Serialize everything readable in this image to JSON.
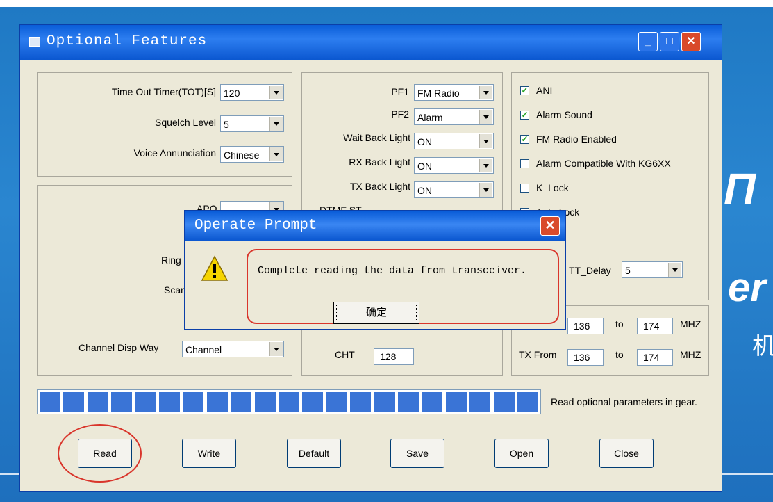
{
  "window": {
    "title": "Optional Features",
    "min": "_",
    "max": "□",
    "close": "✕"
  },
  "timers": {
    "tot_label": "Time Out Timer(TOT)[S]",
    "tot_value": "120",
    "squelch_label": "Squelch Level",
    "squelch_value": "5",
    "voice_label": "Voice Annunciation",
    "voice_value": "Chinese"
  },
  "mid": {
    "pf1_label": "PF1",
    "pf1_value": "FM Radio",
    "pf2_label": "PF2",
    "pf2_value": "Alarm",
    "wait_label": "Wait Back Light",
    "wait_value": "ON",
    "rx_label": "RX Back Light",
    "rx_value": "ON",
    "tx_label": "TX Back Light",
    "tx_value": "ON",
    "dtmf_label": "DTMF ST",
    "cht_label": "CHT",
    "cht_value": "128"
  },
  "left2": {
    "apo_label": "APO",
    "ring_label": "Ring",
    "scan_label": "Scan",
    "disp_label": "Channel Disp Way",
    "disp_value": "Channel"
  },
  "checks": [
    {
      "label": "ANI",
      "checked": true
    },
    {
      "label": "Alarm Sound",
      "checked": true
    },
    {
      "label": "FM Radio Enabled",
      "checked": true
    },
    {
      "label": "Alarm Compatible With KG6XX",
      "checked": false
    },
    {
      "label": "K_Lock",
      "checked": false
    },
    {
      "label": "Auto Lock",
      "checked": false
    }
  ],
  "dtmf_delay": {
    "label": "TT_Delay",
    "value": "5"
  },
  "freq": {
    "rx_to": "to",
    "rx_from_value": "136",
    "rx_to_value": "174",
    "rx_unit": "MHZ",
    "tx_label": "TX From",
    "tx_from_value": "136",
    "tx_to": "to",
    "tx_to_value": "174",
    "tx_unit": "MHZ"
  },
  "progress": {
    "blocks": 21,
    "status": "Read optional parameters in gear."
  },
  "buttons": {
    "read": "Read",
    "write": "Write",
    "default": "Default",
    "save": "Save",
    "open": "Open",
    "close": "Close"
  },
  "dialog": {
    "title": "Operate Prompt",
    "message": "Complete reading the data from transceiver.",
    "ok": "确定",
    "close": "✕"
  },
  "background": {
    "text1": "П",
    "text2": "er",
    "text3": "机"
  }
}
